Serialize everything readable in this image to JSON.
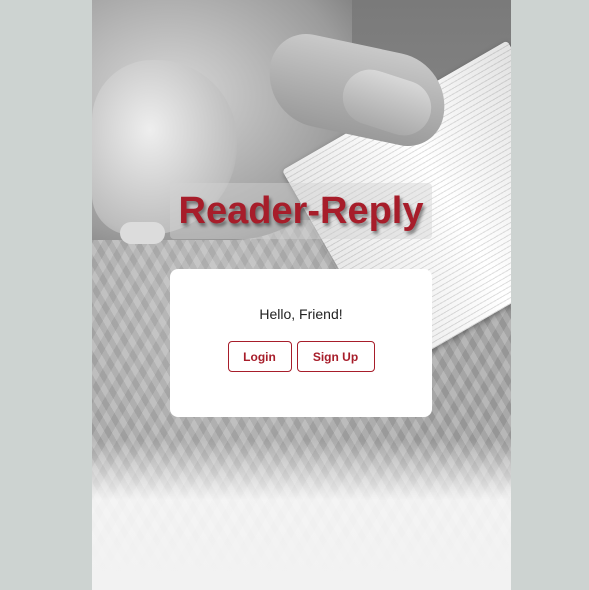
{
  "site": {
    "title": "Reader-Reply",
    "brand_color": "#a71d2a"
  },
  "hero": {
    "image_icon": "photo-background-icon"
  },
  "card": {
    "greeting": "Hello, Friend!",
    "login_label": "Login",
    "signup_label": "Sign Up"
  },
  "colors": {
    "page_background": "#cdd3d1",
    "card_background": "#ffffff",
    "accent": "#a71d2a"
  }
}
